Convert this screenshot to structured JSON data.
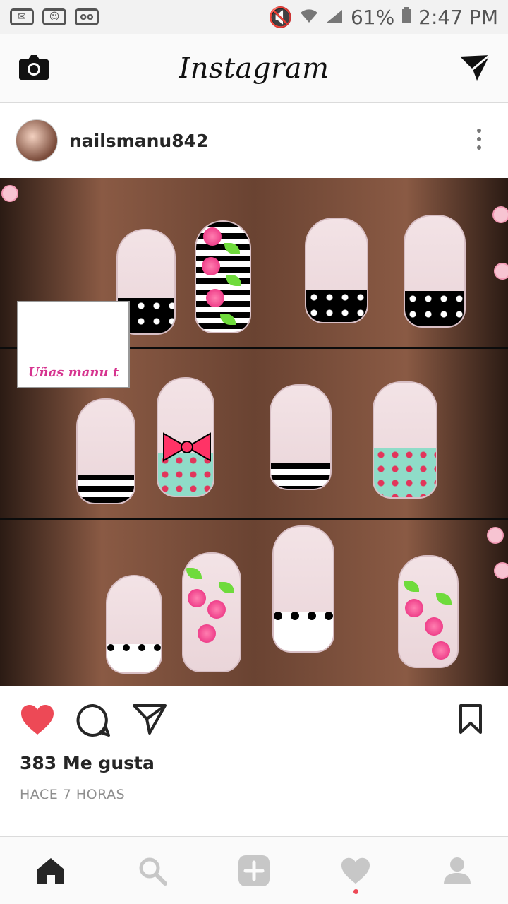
{
  "status_bar": {
    "battery": "61%",
    "time": "2:47 PM",
    "left_icons": [
      "mail-icon",
      "app-icon",
      "voicemail-icon"
    ],
    "right_icons": [
      "mute-icon",
      "wifi-icon",
      "signal-icon",
      "battery-icon"
    ]
  },
  "header": {
    "logo": "Instagram",
    "left_icon": "camera-icon",
    "right_icon": "direct-message-icon"
  },
  "post": {
    "username": "nailsmanu842",
    "image_watermark": "Uñas manu t",
    "likes": "383 Me gusta",
    "timestamp": "HACE 7 HORAS"
  },
  "colors": {
    "like_red": "#ed4956",
    "text": "#262626",
    "muted": "#8e8e8e",
    "bar_bg": "#fafafa"
  },
  "tabs": [
    "home-icon",
    "search-icon",
    "add-icon",
    "activity-icon",
    "profile-icon"
  ]
}
